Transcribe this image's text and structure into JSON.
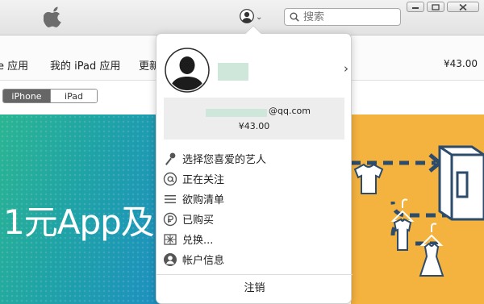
{
  "titlebar": {
    "search_placeholder": "搜索"
  },
  "nav": {
    "items": [
      {
        "label": "e 应用"
      },
      {
        "label": "我的 iPad 应用"
      },
      {
        "label": "更新"
      }
    ],
    "balance": "¥43.00"
  },
  "device_switch": {
    "options": [
      {
        "label": "iPhone",
        "selected": true
      },
      {
        "label": "iPad",
        "selected": false
      }
    ]
  },
  "banner": {
    "title": "1元App及"
  },
  "account_menu": {
    "email_suffix": "@qq.com",
    "balance": "¥43.00",
    "items": [
      {
        "label": "选择您喜爱的艺人",
        "icon": "microphone-icon"
      },
      {
        "label": "正在关注",
        "icon": "at-sign-icon"
      },
      {
        "label": "欲购清单",
        "icon": "list-icon"
      },
      {
        "label": "已购买",
        "icon": "purchased-icon"
      },
      {
        "label": "兑换...",
        "icon": "gift-card-icon"
      },
      {
        "label": "帐户信息",
        "icon": "account-icon"
      }
    ],
    "sign_out": "注销"
  },
  "colors": {
    "banner_left_start": "#2bb592",
    "banner_left_end": "#1d8fc2",
    "banner_right": "#f4b23f",
    "redacted": "#cfe6da"
  }
}
